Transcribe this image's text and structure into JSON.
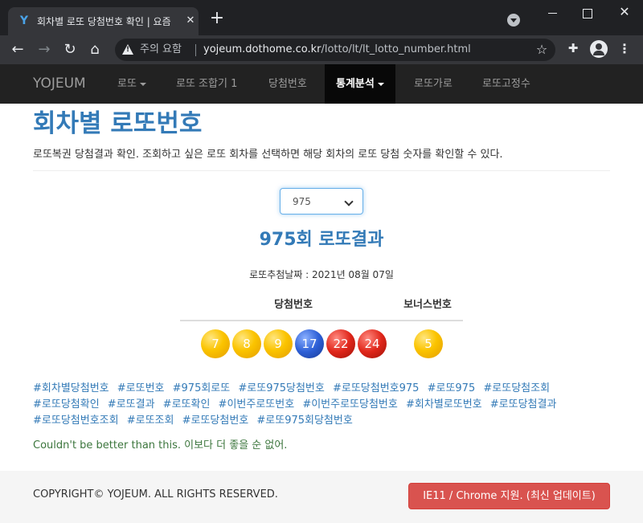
{
  "browser": {
    "tab_title": "회차별 로또 당첨번호 확인 | 요즘",
    "tab_favicon": "Y",
    "security_label": "주의 요함",
    "url_host": "yojeum.dothome.co.kr",
    "url_path": "/lotto/lt/lt_lotto_number.html"
  },
  "navbar": {
    "brand": "YOJEUM",
    "items": [
      {
        "label": "로또",
        "dropdown": true
      },
      {
        "label": "로또 조합기 1",
        "dropdown": false
      },
      {
        "label": "당첨번호",
        "dropdown": false
      },
      {
        "label": "통계분석",
        "dropdown": true,
        "active": true
      },
      {
        "label": "로또가로",
        "dropdown": false
      },
      {
        "label": "로또고정수",
        "dropdown": false
      }
    ]
  },
  "page": {
    "title": "회차별 로또번호",
    "description": "로또복권 당첨결과 확인. 조회하고 싶은 로또 회차를 선택하면 해당 회차의 로또 당첨 숫자를 확인할 수 있다.",
    "selected_round": "975",
    "result_title": "975회 로또결과",
    "draw_date": "로또추첨날짜 : 2021년 08월 07일",
    "header_win": "당첨번호",
    "header_bonus": "보너스번호"
  },
  "balls": [
    {
      "number": "7",
      "color": "#fbc400"
    },
    {
      "number": "8",
      "color": "#fbc400"
    },
    {
      "number": "9",
      "color": "#fbc400"
    },
    {
      "number": "17",
      "color": "#2d5fd6"
    },
    {
      "number": "22",
      "color": "#e0261a"
    },
    {
      "number": "24",
      "color": "#e0261a"
    }
  ],
  "bonus_ball": {
    "number": "5",
    "color": "#fbc400"
  },
  "hashtags": [
    "#회차별당첨번호",
    "#로또번호",
    "#975회로또",
    "#로또975당첨번호",
    "#로또당첨번호975",
    "#로또975",
    "#로또당첨조회",
    "#로또당첨확인",
    "#로또결과",
    "#로또확인",
    "#이번주로또번호",
    "#이번주로또당첨번호",
    "#회차별로또번호",
    "#로또당첨결과",
    "#로또당첨번호조회",
    "#로또조회",
    "#로또당첨번호",
    "#로또975회당첨번호"
  ],
  "quote": "Couldn't be better than this. 이보다 더 좋을 순 없어.",
  "footer": {
    "copyright": "COPYRIGHT© YOJEUM. ALL RIGHTS RESERVED.",
    "button": "IE11 / Chrome 지원. (최신 업데이트)"
  },
  "colors": {
    "link": "#337ab7",
    "navbar_bg": "#222222",
    "footer_button": "#d9534f",
    "quote": "#3c763d"
  }
}
